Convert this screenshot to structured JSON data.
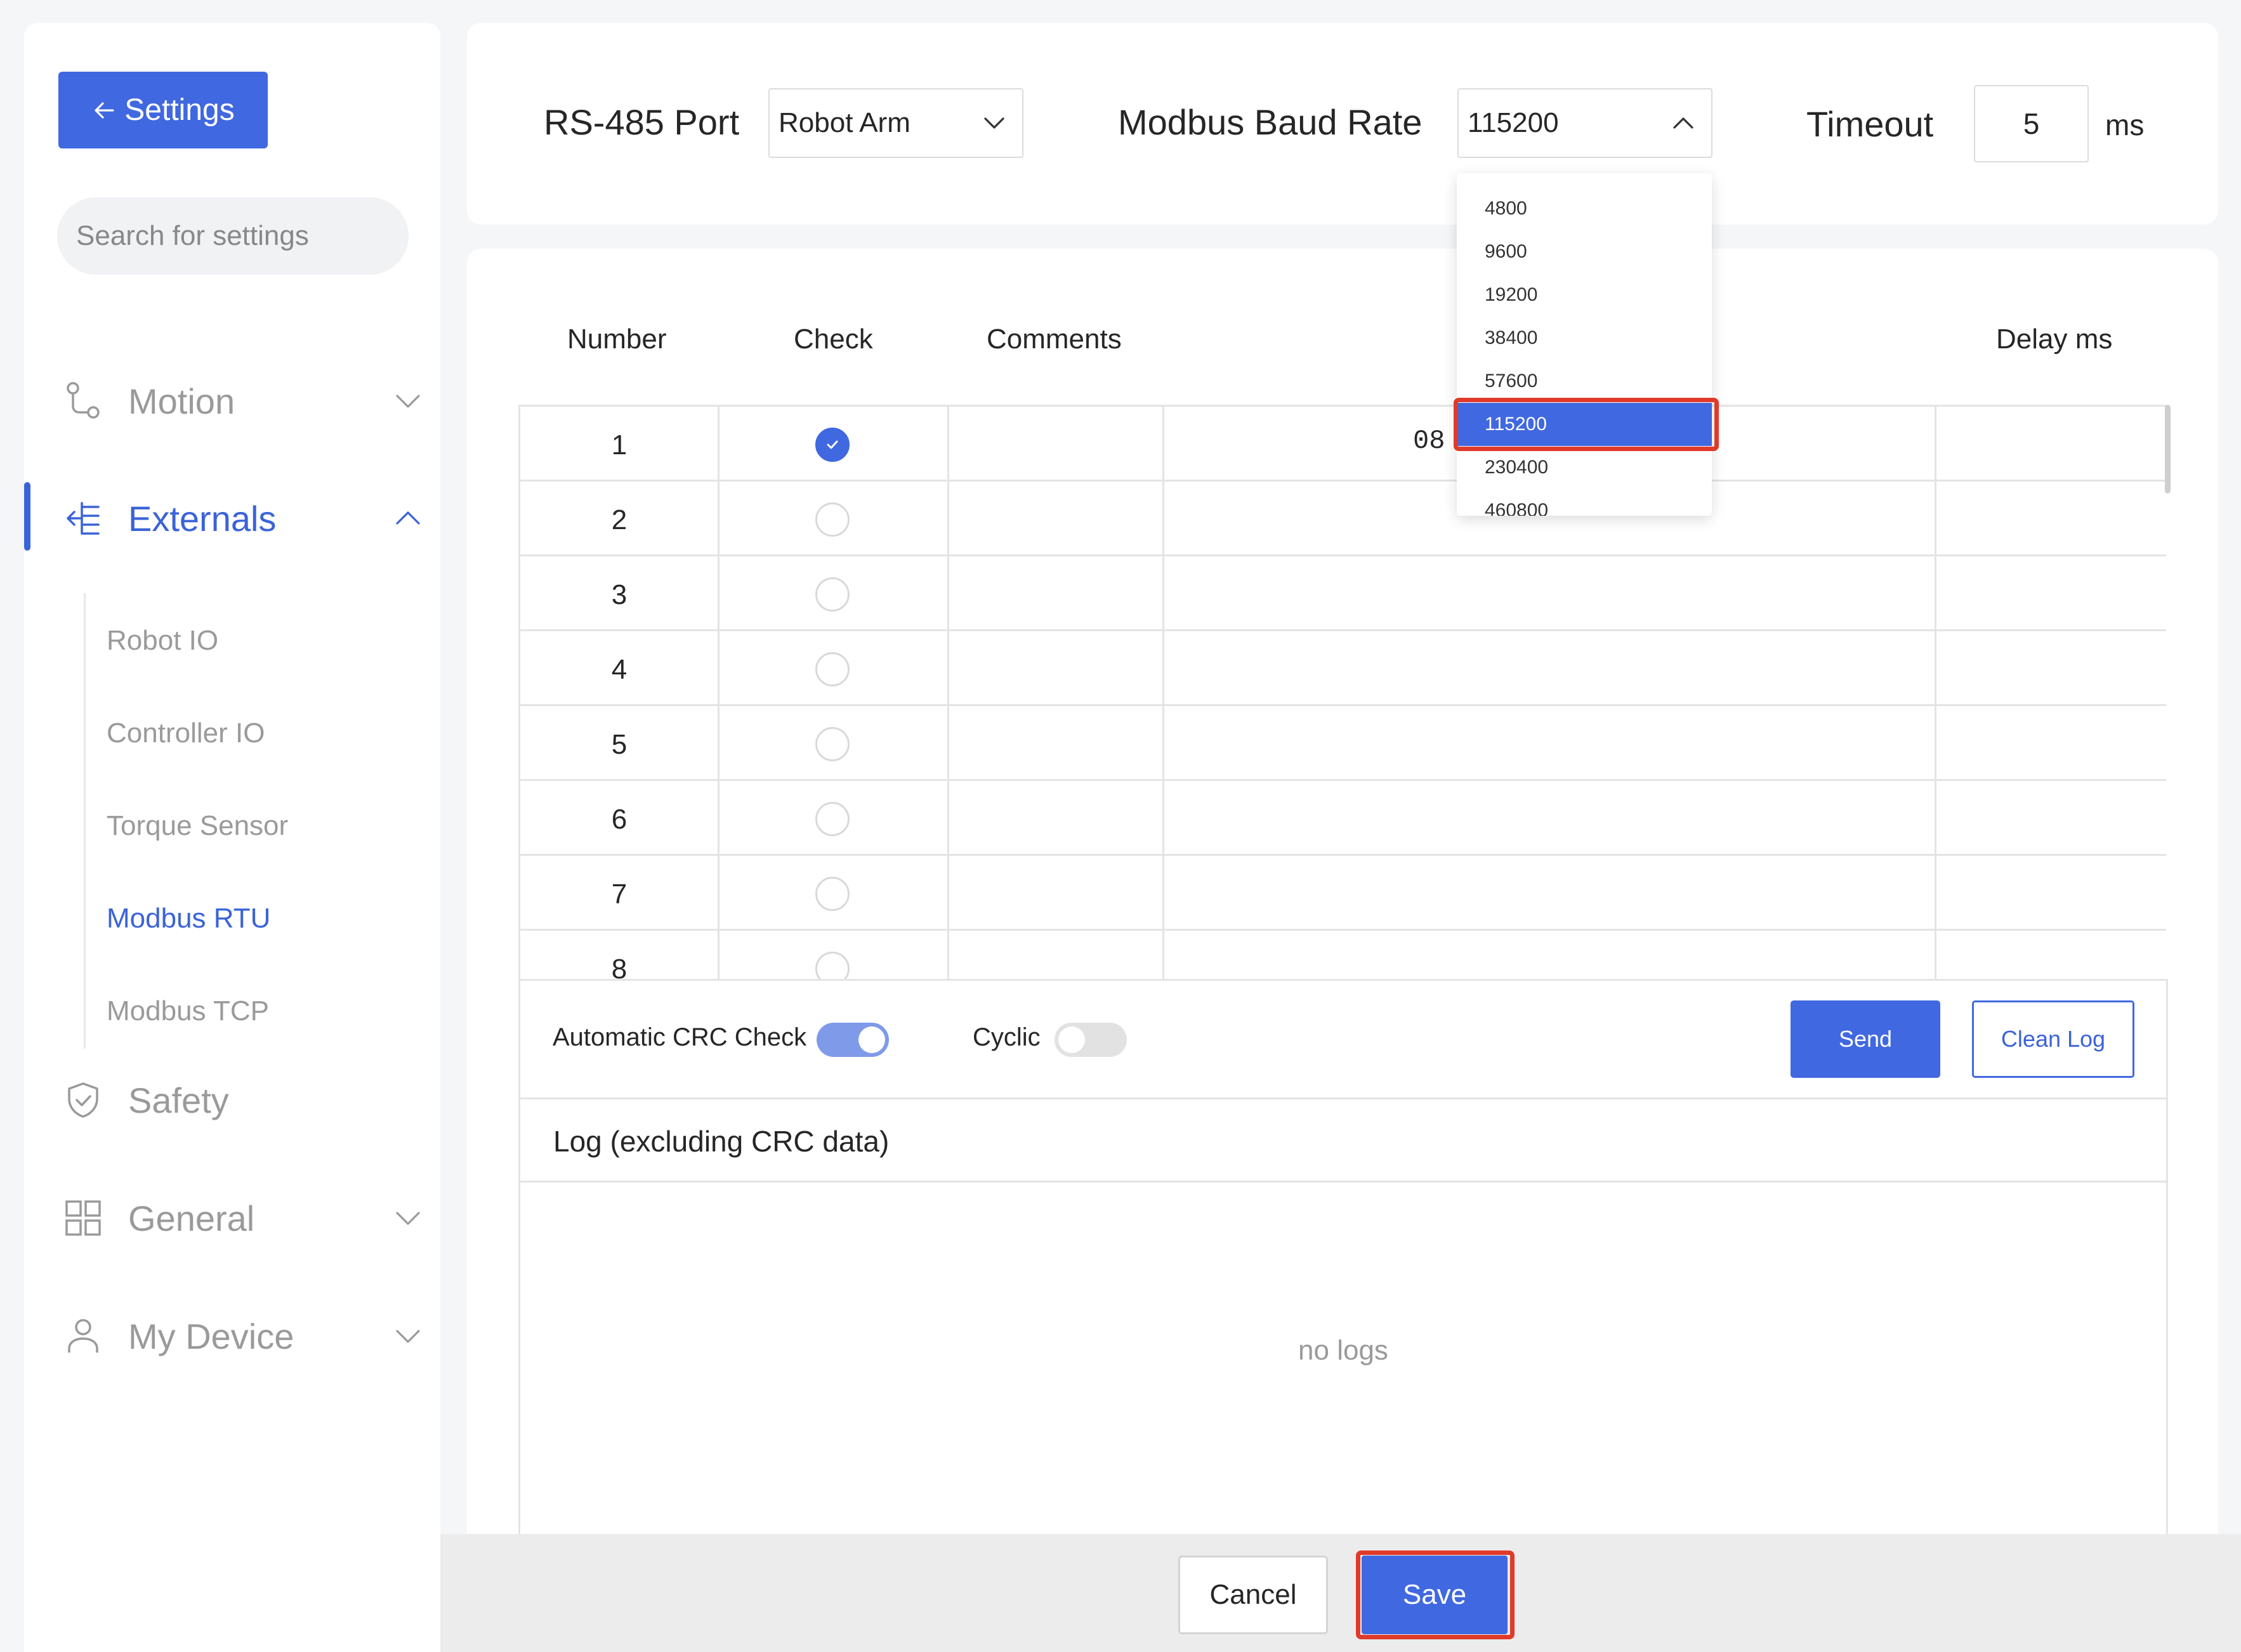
{
  "sidebar": {
    "back_label": "Settings",
    "search_placeholder": "Search for settings",
    "groups": {
      "motion": "Motion",
      "externals": "Externals",
      "safety": "Safety",
      "general": "General",
      "my_device": "My Device"
    },
    "externals_items": [
      "Robot IO",
      "Controller IO",
      "Torque Sensor",
      "Modbus RTU",
      "Modbus TCP"
    ],
    "active_item": "Modbus RTU"
  },
  "config": {
    "port_label": "RS-485 Port",
    "port_value": "Robot Arm",
    "baud_label": "Modbus Baud Rate",
    "baud_value": "115200",
    "timeout_label": "Timeout",
    "timeout_value": "5",
    "timeout_unit": "ms"
  },
  "baud_dropdown": {
    "options": [
      "4800",
      "9600",
      "19200",
      "38400",
      "57600",
      "115200",
      "230400",
      "460800"
    ],
    "selected": "115200"
  },
  "table": {
    "headers": {
      "number": "Number",
      "check": "Check",
      "comments": "Comments",
      "delay": "Delay ms"
    },
    "rows": [
      {
        "number": "1",
        "checked": true,
        "data": "08"
      },
      {
        "number": "2",
        "checked": false,
        "data": ""
      },
      {
        "number": "3",
        "checked": false,
        "data": ""
      },
      {
        "number": "4",
        "checked": false,
        "data": ""
      },
      {
        "number": "5",
        "checked": false,
        "data": ""
      },
      {
        "number": "6",
        "checked": false,
        "data": ""
      },
      {
        "number": "7",
        "checked": false,
        "data": ""
      },
      {
        "number": "8",
        "checked": false,
        "data": ""
      }
    ]
  },
  "controls": {
    "crc_label": "Automatic CRC Check",
    "crc_on": true,
    "cyclic_label": "Cyclic",
    "cyclic_on": false,
    "send_label": "Send",
    "clean_log_label": "Clean Log"
  },
  "log": {
    "title": "Log (excluding CRC data)",
    "empty_text": "no logs"
  },
  "footer": {
    "cancel_label": "Cancel",
    "save_label": "Save"
  },
  "colors": {
    "accent": "#4068e0",
    "highlight": "#e03a2a",
    "muted_text": "#9a9a9a"
  }
}
